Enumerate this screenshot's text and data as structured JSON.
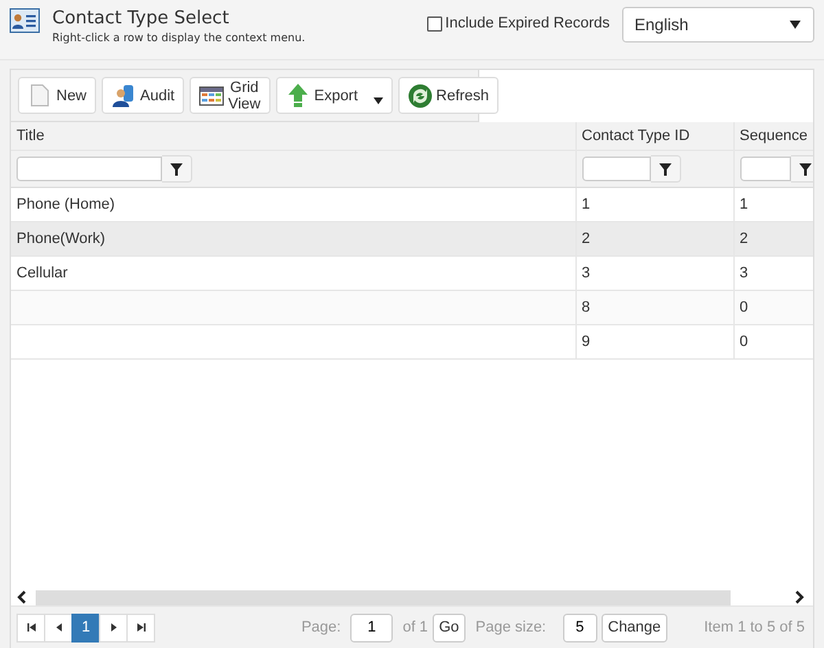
{
  "header": {
    "title": "Contact Type Select",
    "subtitle": "Right-click a row to display the context menu.",
    "include_expired": {
      "label": "Include Expired Records",
      "checked": false
    },
    "language": {
      "value": "English"
    }
  },
  "toolbar": [
    {
      "label": "New",
      "kind": "new"
    },
    {
      "label": "Audit",
      "kind": "audit"
    },
    {
      "label": "Grid View",
      "kind": "grid"
    },
    {
      "label": "Export",
      "kind": "export"
    },
    {
      "label": "Refresh",
      "kind": "refresh"
    }
  ],
  "table": {
    "columns": [
      "Title",
      "Contact Type ID",
      "Sequence"
    ],
    "rows": [
      {
        "cells": [
          "Phone (Home)",
          "1",
          "1"
        ],
        "selected": false
      },
      {
        "cells": [
          "Phone(Work)",
          "2",
          "2"
        ],
        "selected": true
      },
      {
        "cells": [
          "Cellular",
          "3",
          "3"
        ],
        "selected": false
      },
      {
        "cells": [
          "",
          "8",
          "0"
        ],
        "selected": false
      },
      {
        "cells": [
          "",
          "9",
          "0"
        ],
        "selected": false
      }
    ]
  },
  "pager": {
    "pages": [
      {
        "label": "1",
        "selected": true
      }
    ],
    "page_label": "Page:",
    "page_value": "1",
    "of": "of 1",
    "go": "Go",
    "size_label": "Page size:",
    "size_value": "5",
    "change": "Change",
    "summary": "Item 1 to 5 of 5"
  }
}
